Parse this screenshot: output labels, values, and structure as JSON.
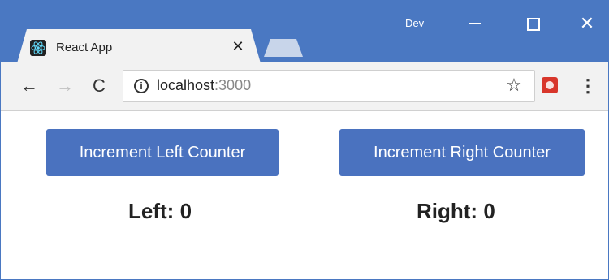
{
  "window": {
    "profile_label": "Dev",
    "colors": {
      "titlebar": "#4a78c2",
      "toolbar": "#f2f2f2",
      "button": "#4a72bf"
    }
  },
  "tabs": [
    {
      "title": "React App",
      "active": true,
      "favicon": "react-icon"
    }
  ],
  "toolbar": {
    "url_host": "localhost",
    "url_port": ":3000",
    "icons": [
      "back-arrow-icon",
      "forward-arrow-icon",
      "reload-icon",
      "info-icon",
      "star-icon",
      "extension-icon",
      "menu-icon"
    ]
  },
  "content": {
    "left_button_label": "Increment Left Counter",
    "right_button_label": "Increment Right Counter",
    "left_counter_label": "Left:",
    "left_counter_value": "0",
    "right_counter_label": "Right:",
    "right_counter_value": "0"
  }
}
